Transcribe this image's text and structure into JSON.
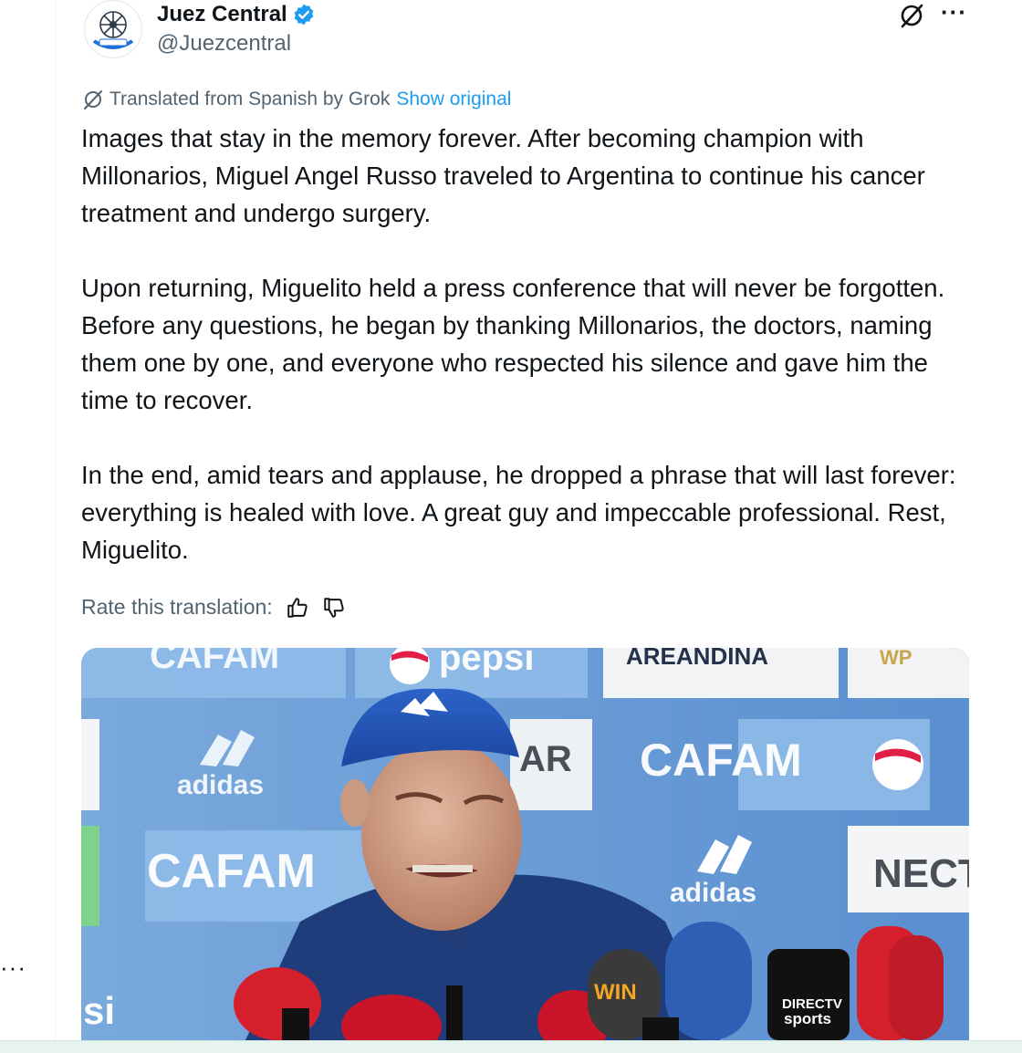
{
  "author": {
    "name": "Juez Central",
    "handle": "@Juezcentral",
    "avatar_icon": "juez-central-logo"
  },
  "header_actions": {
    "grok_icon": "grok-icon",
    "more_label": "···"
  },
  "translation": {
    "label": "Translated from Spanish by Grok",
    "show_original": "Show original"
  },
  "tweet": {
    "paragraphs": [
      "Images that stay in the memory forever. After becoming champion with Millonarios, Miguel Angel Russo traveled to Argentina to continue his cancer treatment and undergo surgery.",
      "Upon returning, Miguelito held a press conference that will never be forgotten. Before any questions, he began by thanking Millonarios, the doctors, naming them one by one, and everyone who respected his silence and gave him the time to recover.",
      "In the end, amid tears and applause, he dropped a phrase that will last forever: everything is healed with love. A great guy and impeccable professional. Rest, Miguelito."
    ]
  },
  "rate": {
    "label": "Rate this translation:",
    "up_icon": "thumbs-up-icon",
    "down_icon": "thumbs-down-icon"
  },
  "media": {
    "sponsor_labels": [
      "CAFAM",
      "pepsi",
      "AREANDINA",
      "adidas",
      "AR",
      "CAFAM",
      "adidas",
      "NECT",
      "si",
      "WIN",
      "DIRECTV sports"
    ]
  },
  "sidebar": {
    "dots": "···"
  },
  "colors": {
    "link": "#1d9bf0",
    "muted": "#536471",
    "text": "#0f1419",
    "verified": "#1d9bf0",
    "backdrop": "#5e93cf"
  }
}
